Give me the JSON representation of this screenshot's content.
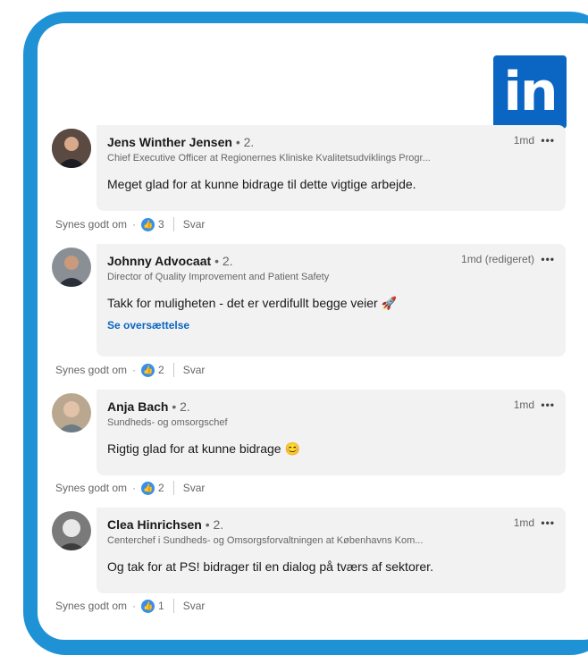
{
  "brand": {
    "logo_text": "in",
    "accent": "#1f92d6",
    "linkedin_blue": "#0a66c2"
  },
  "comments": [
    {
      "name": "Jens Winther Jensen",
      "degree": "• 2.",
      "title": "Chief Executive Officer at Regionernes Kliniske Kvalitetsudviklings Progr...",
      "time": "1md",
      "more": "•••",
      "text": "Meget glad for at kunne bidrage til dette vigtige arbejde.",
      "like_label": "Synes godt om",
      "dot": "·",
      "like_count": "3",
      "reply_label": "Svar"
    },
    {
      "name": "Johnny Advocaat",
      "degree": "• 2.",
      "title": "Director of Quality Improvement and Patient Safety",
      "time": "1md (redigeret)",
      "more": "•••",
      "text": "Takk for muligheten - det er verdifullt begge veier 🚀",
      "translate": "Se oversættelse",
      "like_label": "Synes godt om",
      "dot": "·",
      "like_count": "2",
      "reply_label": "Svar"
    },
    {
      "name": "Anja Bach",
      "degree": "• 2.",
      "title": "Sundheds- og omsorgschef",
      "time": "1md",
      "more": "•••",
      "text": "Rigtig glad for at kunne bidrage 😊",
      "like_label": "Synes godt om",
      "dot": "·",
      "like_count": "2",
      "reply_label": "Svar"
    },
    {
      "name": "Clea Hinrichsen",
      "degree": "• 2.",
      "title": "Centerchef i Sundheds- og Omsorgsforvaltningen at Københavns Kom...",
      "time": "1md",
      "more": "•••",
      "text": "Og tak for at PS! bidrager til en dialog på tværs af sektorer.",
      "like_label": "Synes godt om",
      "dot": "·",
      "like_count": "1",
      "reply_label": "Svar"
    }
  ]
}
